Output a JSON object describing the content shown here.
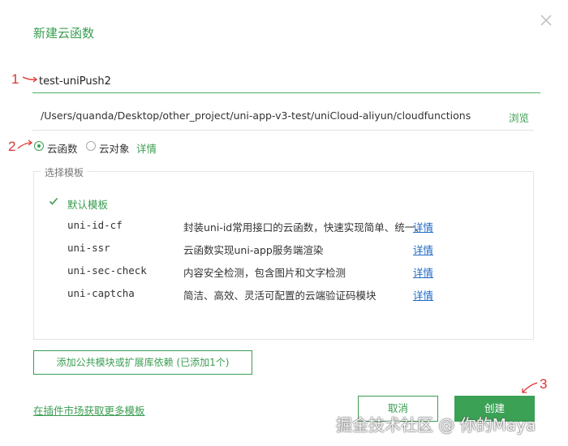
{
  "dialog": {
    "title": "新建云函数"
  },
  "name_field": {
    "value": "test-uniPush2"
  },
  "path": {
    "text": "/Users/quanda/Desktop/other_project/uni-app-v3-test/uniCloud-aliyun/cloudfunctions",
    "browse_label": "浏览"
  },
  "type_options": {
    "cloud_function": "云函数",
    "cloud_object": "云对象",
    "details": "详情"
  },
  "templates": {
    "legend": "选择模板",
    "default_label": "默认模板",
    "items": [
      {
        "name": "uni-id-cf",
        "desc": "封装uni-id常用接口的云函数，快速实现简单、统一、",
        "link": "详情"
      },
      {
        "name": "uni-ssr",
        "desc": "云函数实现uni-app服务端渲染",
        "link": "详情"
      },
      {
        "name": "uni-sec-check",
        "desc": "内容安全检测，包含图片和文字检测",
        "link": "详情"
      },
      {
        "name": "uni-captcha",
        "desc": "简洁、高效、灵活可配置的云端验证码模块",
        "link": "详情"
      }
    ]
  },
  "buttons": {
    "add_deps": "添加公共模块或扩展库依赖 (已添加1个)",
    "market_link": "在插件市场获取更多模板",
    "cancel": "取消",
    "create": "创建"
  },
  "annotations": {
    "n1": "1",
    "n2": "2",
    "n3": "3"
  },
  "watermark": "掘金技术社区 @ 你的Maya",
  "colors": {
    "accent": "#3a9d51",
    "link_blue": "#1e68c5",
    "annotation_red": "#dd3333"
  }
}
